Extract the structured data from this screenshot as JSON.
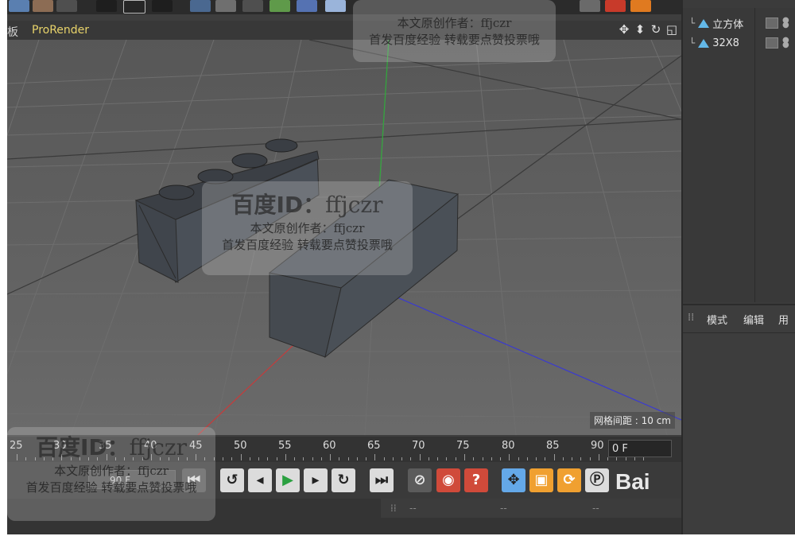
{
  "viewport_header": {
    "menu_first": "板",
    "menu_prorender": "ProRender"
  },
  "nav_icons": [
    "move-view-icon",
    "dolly-view-icon",
    "rotate-view-icon",
    "toggle-view-icon"
  ],
  "viewport": {
    "grid_spacing_label": "网格间距 : 10 cm"
  },
  "object_manager": {
    "items": [
      {
        "label": "立方体",
        "icon": "cube-object-icon"
      },
      {
        "label": "32X8",
        "icon": "cube-object-icon"
      }
    ]
  },
  "attribute_manager": {
    "tabs": [
      "模式",
      "编辑",
      "用"
    ]
  },
  "timeline": {
    "ticks": [
      "25",
      "30",
      "35",
      "40",
      "45",
      "50",
      "55",
      "60",
      "65",
      "70",
      "75",
      "80",
      "85",
      "90"
    ],
    "current_frame": "0 F"
  },
  "transport": {
    "end_frame": "90 F"
  },
  "bottom_panel": {
    "placeholders": [
      "--",
      "--",
      "--"
    ]
  },
  "watermarks": {
    "id_prefix": "百度ID：",
    "id_value": "ffjczr",
    "author_line": "本文原创作者：ffjczr",
    "notice_line": "首发百度经验 转载要点赞投票哦"
  },
  "logo_text": "Bai"
}
